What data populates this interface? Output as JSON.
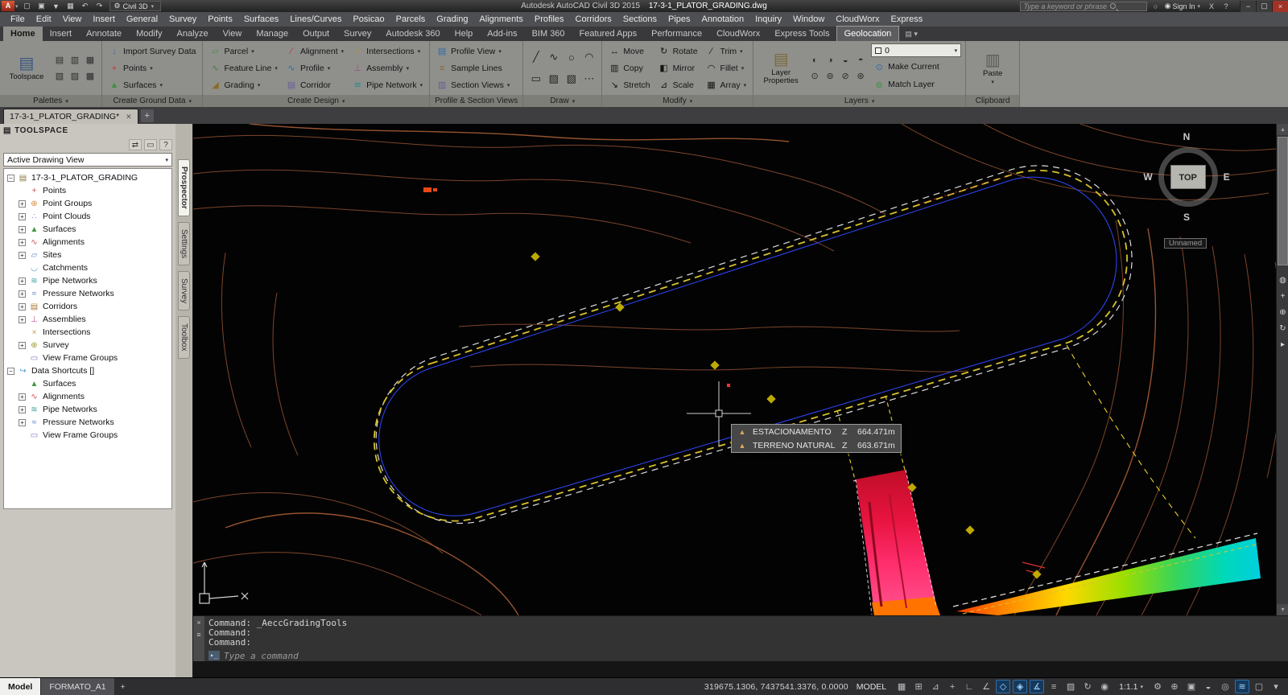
{
  "title_bar": {
    "product": "Autodesk AutoCAD Civil 3D 2015",
    "file": "17-3-1_PLATOR_GRADING.dwg",
    "workspace": "Civil 3D",
    "search_placeholder": "Type a keyword or phrase",
    "sign_in": "Sign In",
    "exchange_label": "X",
    "help_label": "?",
    "qat_icons": [
      {
        "name": "new",
        "glyph": "▢"
      },
      {
        "name": "open",
        "glyph": "▣"
      },
      {
        "name": "save",
        "glyph": "▼"
      },
      {
        "name": "plot",
        "glyph": "▦"
      },
      {
        "name": "undo",
        "glyph": "↶"
      },
      {
        "name": "redo",
        "glyph": "↷"
      }
    ]
  },
  "menu_bar": {
    "items": [
      "File",
      "Edit",
      "View",
      "Insert",
      "General",
      "Survey",
      "Points",
      "Surfaces",
      "Lines/Curves",
      "Posicao",
      "Parcels",
      "Grading",
      "Alignments",
      "Profiles",
      "Corridors",
      "Sections",
      "Pipes",
      "Annotation",
      "Inquiry",
      "Window",
      "CloudWorx",
      "Express"
    ]
  },
  "ribbon": {
    "tabs": [
      {
        "label": "Home",
        "active": true
      },
      {
        "label": "Insert"
      },
      {
        "label": "Annotate"
      },
      {
        "label": "Modify"
      },
      {
        "label": "Analyze"
      },
      {
        "label": "View"
      },
      {
        "label": "Manage"
      },
      {
        "label": "Output"
      },
      {
        "label": "Survey"
      },
      {
        "label": "Autodesk 360"
      },
      {
        "label": "Help"
      },
      {
        "label": "Add-ins"
      },
      {
        "label": "BIM 360"
      },
      {
        "label": "Featured Apps"
      },
      {
        "label": "Performance"
      },
      {
        "label": "CloudWorx"
      },
      {
        "label": "Express Tools"
      },
      {
        "label": "Geolocation",
        "highlighted": true
      }
    ],
    "panels": {
      "palettes": {
        "label": "Palettes",
        "toolspace": "Toolspace",
        "mini_icons": [
          {
            "name": "properties-palette",
            "glyph": "▤"
          },
          {
            "name": "tool-palettes",
            "glyph": "▥"
          },
          {
            "name": "sheet-set-manager",
            "glyph": "▦"
          },
          {
            "name": "command-line",
            "glyph": "▧"
          },
          {
            "name": "design-center",
            "glyph": "▨"
          },
          {
            "name": "object-viewer",
            "glyph": "▩"
          }
        ]
      },
      "ground": {
        "label": "Create Ground Data",
        "import_survey": "Import Survey Data",
        "points": "Points",
        "surfaces": "Surfaces"
      },
      "design": {
        "label": "Create Design",
        "parcel": "Parcel",
        "feature_line": "Feature Line",
        "grading": "Grading",
        "alignment": "Alignment",
        "profile": "Profile",
        "corridor": "Corridor",
        "intersections": "Intersections",
        "assembly": "Assembly",
        "pipe_network": "Pipe Network"
      },
      "views": {
        "label": "Profile & Section Views",
        "profile_view": "Profile View",
        "sample_lines": "Sample Lines",
        "section_views": "Section Views"
      },
      "draw": {
        "label": "Draw",
        "icons": [
          {
            "name": "line",
            "glyph": "╱"
          },
          {
            "name": "polyline",
            "glyph": "∿"
          },
          {
            "name": "circle",
            "glyph": "○"
          },
          {
            "name": "arc",
            "glyph": "◠"
          },
          {
            "name": "rectangle",
            "glyph": "▭"
          },
          {
            "name": "hatch",
            "glyph": "▨"
          },
          {
            "name": "gradient-fill",
            "glyph": "▧"
          },
          {
            "name": "more-draw-tools",
            "glyph": "⋯"
          }
        ]
      },
      "modify": {
        "label": "Modify",
        "move": "Move",
        "copy": "Copy",
        "stretch": "Stretch",
        "rotate": "Rotate",
        "mirror": "Mirror",
        "scale": "Scale",
        "trim": "Trim",
        "fillet": "Fillet",
        "array": "Array"
      },
      "layers": {
        "label": "Layers",
        "layer_properties": "Layer Properties",
        "current_layer": "0",
        "make_current": "Make Current",
        "match_layer": "Match Layer",
        "mini_icons": [
          {
            "name": "layer-off",
            "glyph": "◐"
          },
          {
            "name": "layer-isolate",
            "glyph": "◑"
          },
          {
            "name": "layer-freeze",
            "glyph": "◒"
          },
          {
            "name": "layer-lock",
            "glyph": "◓"
          },
          {
            "name": "layer-on",
            "glyph": "⊙"
          },
          {
            "name": "layer-thaw",
            "glyph": "⊚"
          },
          {
            "name": "layer-unlock",
            "glyph": "⊘"
          },
          {
            "name": "layer-previous",
            "glyph": "⊛"
          }
        ]
      },
      "clipboard": {
        "label": "Clipboard",
        "paste": "Paste"
      }
    }
  },
  "document_tabs": {
    "tabs": [
      {
        "label": "17-3-1_PLATOR_GRADING*"
      }
    ],
    "new_tab_label": "+"
  },
  "toolspace": {
    "title": "TOOLSPACE",
    "menu_icon": {
      "name": "palette-properties",
      "glyph": "▤"
    },
    "toolbar_icons": [
      {
        "name": "item-view",
        "glyph": "⇄"
      },
      {
        "name": "preview-pane",
        "glyph": "▭"
      },
      {
        "name": "help",
        "glyph": "?"
      }
    ],
    "view_selector": "Active Drawing View",
    "tree": [
      {
        "label": "17-3-1_PLATOR_GRADING",
        "depth": 0,
        "expander": "minus",
        "icon": "drawing"
      },
      {
        "label": "Points",
        "depth": 1,
        "expander": "none",
        "icon": "points"
      },
      {
        "label": "Point Groups",
        "depth": 1,
        "expander": "plus",
        "icon": "point-groups"
      },
      {
        "label": "Point Clouds",
        "depth": 1,
        "expander": "plus",
        "icon": "point-clouds"
      },
      {
        "label": "Surfaces",
        "depth": 1,
        "expander": "plus",
        "icon": "surfaces"
      },
      {
        "label": "Alignments",
        "depth": 1,
        "expander": "plus",
        "icon": "alignments"
      },
      {
        "label": "Sites",
        "depth": 1,
        "expander": "plus",
        "icon": "sites"
      },
      {
        "label": "Catchments",
        "depth": 1,
        "expander": "none",
        "icon": "catchments"
      },
      {
        "label": "Pipe Networks",
        "depth": 1,
        "expander": "plus",
        "icon": "pipe-networks"
      },
      {
        "label": "Pressure Networks",
        "depth": 1,
        "expander": "plus",
        "icon": "pressure-networks"
      },
      {
        "label": "Corridors",
        "depth": 1,
        "expander": "plus",
        "icon": "corridors"
      },
      {
        "label": "Assemblies",
        "depth": 1,
        "expander": "plus",
        "icon": "assemblies"
      },
      {
        "label": "Intersections",
        "depth": 1,
        "expander": "none",
        "icon": "intersections"
      },
      {
        "label": "Survey",
        "depth": 1,
        "expander": "plus",
        "icon": "survey"
      },
      {
        "label": "View Frame Groups",
        "depth": 1,
        "expander": "none",
        "icon": "view-frame-groups"
      },
      {
        "label": "Data Shortcuts []",
        "depth": 0,
        "expander": "minus",
        "icon": "data-shortcuts"
      },
      {
        "label": "Surfaces",
        "depth": 1,
        "expander": "none",
        "icon": "surfaces"
      },
      {
        "label": "Alignments",
        "depth": 1,
        "expander": "plus",
        "icon": "alignments"
      },
      {
        "label": "Pipe Networks",
        "depth": 1,
        "expander": "plus",
        "icon": "pipe-networks"
      },
      {
        "label": "Pressure Networks",
        "depth": 1,
        "expander": "plus",
        "icon": "pressure-networks"
      },
      {
        "label": "View Frame Groups",
        "depth": 1,
        "expander": "none",
        "icon": "view-frame-groups"
      }
    ],
    "side_tabs": [
      {
        "label": "Prospector",
        "active": true
      },
      {
        "label": "Settings"
      },
      {
        "label": "Survey"
      },
      {
        "label": "Toolbox"
      }
    ]
  },
  "canvas": {
    "tooltip": {
      "rows": [
        {
          "name": "ESTACIONAMENTO",
          "axis": "Z",
          "value": "664.471m"
        },
        {
          "name": "TERRENO NATURAL",
          "axis": "Z",
          "value": "663.671m"
        }
      ]
    },
    "viewcube": {
      "north": "N",
      "south": "S",
      "west": "W",
      "east": "E",
      "face": "TOP",
      "view_name": "Unnamed"
    },
    "nav_icons": [
      {
        "name": "navigation-wheel",
        "glyph": "◍"
      },
      {
        "name": "pan",
        "glyph": "+"
      },
      {
        "name": "zoom",
        "glyph": "⊕"
      },
      {
        "name": "orbit",
        "glyph": "↻"
      },
      {
        "name": "showmotion",
        "glyph": "▸"
      }
    ]
  },
  "command": {
    "strip_icons": [
      {
        "name": "close-command-window",
        "glyph": "×"
      },
      {
        "name": "recent-commands",
        "glyph": "≡"
      }
    ],
    "lines": [
      "Command: _AeccGradingTools",
      "Command:",
      "Command:"
    ],
    "input_placeholder": "Type a command"
  },
  "status_bar": {
    "tabs": [
      {
        "label": "Model",
        "active": true
      },
      {
        "label": "FORMATO_A1"
      }
    ],
    "new_layout_label": "+",
    "coordinates": "319675.1306, 7437541.3376, 0.0000",
    "space_label": "MODEL",
    "annotation_scale": "1:1.1",
    "icons_left": [
      {
        "name": "grid-display",
        "glyph": "▦",
        "active": false
      },
      {
        "name": "snap-mode",
        "glyph": "⊞",
        "active": false
      },
      {
        "name": "infer-constraints",
        "glyph": "⊿",
        "active": false
      },
      {
        "name": "dynamic-input",
        "glyph": "+",
        "active": false
      },
      {
        "name": "ortho-mode",
        "glyph": "∟",
        "active": false
      },
      {
        "name": "polar-tracking",
        "glyph": "∠",
        "active": false
      },
      {
        "name": "object-snap",
        "glyph": "◇",
        "active": true
      },
      {
        "name": "3d-object-snap",
        "glyph": "◈",
        "active": true
      },
      {
        "name": "object-snap-tracking",
        "glyph": "∡",
        "active": true
      },
      {
        "name": "lineweight",
        "glyph": "≡",
        "active": false
      },
      {
        "name": "transparency",
        "glyph": "▨",
        "active": false
      },
      {
        "name": "selection-cycling",
        "glyph": "↻",
        "active": false
      },
      {
        "name": "annotation-visibility",
        "glyph": "◉",
        "active": false
      }
    ],
    "icons_right": [
      {
        "name": "workspace-switching",
        "glyph": "⚙",
        "active": false
      },
      {
        "name": "annotation-monitor",
        "glyph": "⊕",
        "active": false
      },
      {
        "name": "quick-properties",
        "glyph": "▣",
        "active": false
      },
      {
        "name": "lock-ui",
        "glyph": "◒",
        "active": false
      },
      {
        "name": "isolate-objects",
        "glyph": "◎",
        "active": false
      },
      {
        "name": "graphics-performance",
        "glyph": "≋",
        "active": true
      },
      {
        "name": "clean-screen",
        "glyph": "▢",
        "active": false
      },
      {
        "name": "customization",
        "glyph": "▾",
        "active": false
      }
    ]
  }
}
